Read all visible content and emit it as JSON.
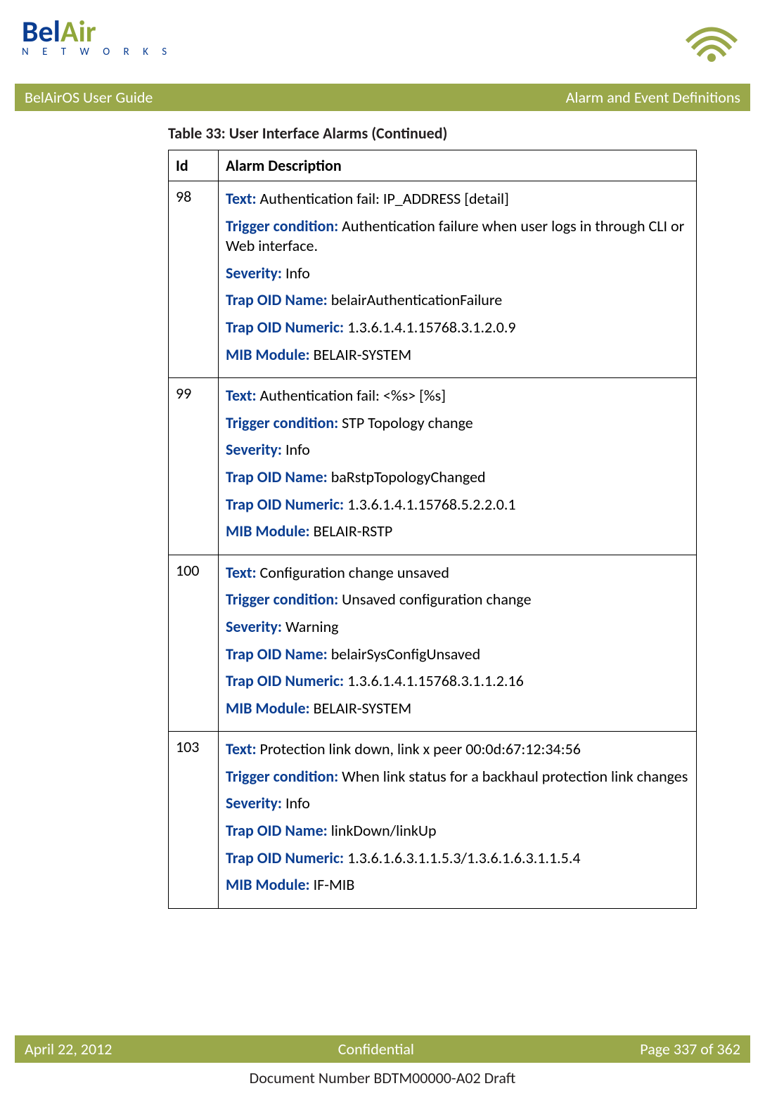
{
  "logo": {
    "part1": "Bel",
    "part2": "Air",
    "sub": "N E T W O R K S"
  },
  "titleBar": {
    "left": "BelAirOS User Guide",
    "right": "Alarm and Event Definitions"
  },
  "tableCaption": "Table 33: User Interface Alarms  (Continued)",
  "headers": {
    "id": "Id",
    "desc": "Alarm Description"
  },
  "labels": {
    "text": "Text:",
    "trigger": "Trigger condition:",
    "severity": "Severity:",
    "trapName": "Trap OID Name:",
    "trapNumeric": "Trap OID Numeric:",
    "mib": "MIB Module:"
  },
  "rows": [
    {
      "id": "98",
      "text": " Authentication fail: IP_ADDRESS [detail]",
      "trigger": " Authentication failure when user logs in through CLI or Web interface.",
      "severity": " Info",
      "trapName": " belairAuthenticationFailure",
      "trapNumeric": " 1.3.6.1.4.1.15768.3.1.2.0.9",
      "mib": " BELAIR-SYSTEM"
    },
    {
      "id": "99",
      "text": " Authentication fail: <%s> [%s]",
      "trigger": " STP Topology change",
      "severity": " Info",
      "trapName": " baRstpTopologyChanged",
      "trapNumeric": " 1.3.6.1.4.1.15768.5.2.2.0.1",
      "mib": " BELAIR-RSTP"
    },
    {
      "id": "100",
      "text": " Configuration change unsaved",
      "trigger": " Unsaved configuration change",
      "severity": " Warning",
      "trapName": " belairSysConfigUnsaved",
      "trapNumeric": " 1.3.6.1.4.1.15768.3.1.1.2.16",
      "mib": " BELAIR-SYSTEM"
    },
    {
      "id": "103",
      "text": " Protection link down, link x peer 00:0d:67:12:34:56",
      "trigger": " When link status for a backhaul protection link changes",
      "severity": " Info",
      "trapName": " linkDown/linkUp",
      "trapNumeric": " 1.3.6.1.6.3.1.1.5.3/1.3.6.1.6.3.1.1.5.4",
      "mib": " IF-MIB"
    }
  ],
  "footerBar": {
    "left": "April 22, 2012",
    "center": "Confidential",
    "right": "Page 337 of 362"
  },
  "docNumber": "Document Number BDTM00000-A02 Draft"
}
